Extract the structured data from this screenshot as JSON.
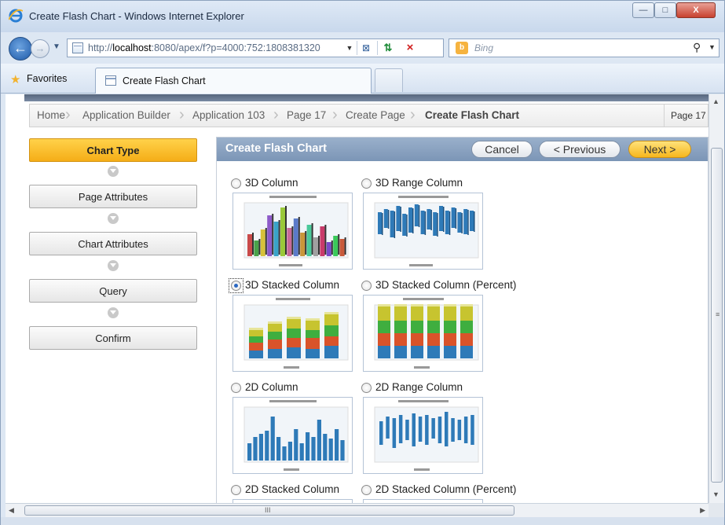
{
  "window": {
    "title": "Create Flash Chart - Windows Internet Explorer",
    "min_glyph": "—",
    "max_glyph": "□",
    "close_glyph": "X"
  },
  "browser": {
    "url_prefix": "http://",
    "url_host": "localhost",
    "url_rest": ":8080/apex/f?p=4000:752:1808381320",
    "search_placeholder": "Bing",
    "search_logo": "b"
  },
  "favorites": {
    "label": "Favorites"
  },
  "tab": {
    "label": "Create Flash Chart"
  },
  "breadcrumb": {
    "items": [
      "Home",
      "Application Builder",
      "Application 103",
      "Page 17",
      "Create Page"
    ],
    "current": "Create Flash Chart",
    "right": "Page 17"
  },
  "wizard": {
    "steps": [
      "Chart Type",
      "Page Attributes",
      "Chart Attributes",
      "Query",
      "Confirm"
    ],
    "active": "Chart Type"
  },
  "region": {
    "title": "Create Flash Chart",
    "cancel": "Cancel",
    "previous": "< Previous",
    "next": "Next >"
  },
  "chart_types": [
    {
      "label": "3D Column",
      "selected": false
    },
    {
      "label": "3D Range Column",
      "selected": false
    },
    {
      "label": "3D Stacked Column",
      "selected": true
    },
    {
      "label": "3D Stacked Column (Percent)",
      "selected": false
    },
    {
      "label": "2D Column",
      "selected": false
    },
    {
      "label": "2D Range Column",
      "selected": false
    },
    {
      "label": "2D Stacked Column",
      "selected": false
    },
    {
      "label": "2D Stacked Column (Percent)",
      "selected": false
    }
  ],
  "icons": {
    "app": "internet-explorer-icon",
    "back": "back-arrow-icon",
    "forward": "forward-arrow-icon",
    "favorites": "star-icon",
    "search": "magnifier-icon",
    "rss": "rss-feed-icon",
    "refresh": "refresh-icon",
    "stop": "stop-icon"
  },
  "colors": {
    "wizard_active": "#f5ad17",
    "region_header": "#7b95b6",
    "next_button": "#f6b61d",
    "chart_blue": "#2e7ab8"
  },
  "scrollbar": {
    "grip_glyph": "≡",
    "hgrip_glyph": "III"
  }
}
